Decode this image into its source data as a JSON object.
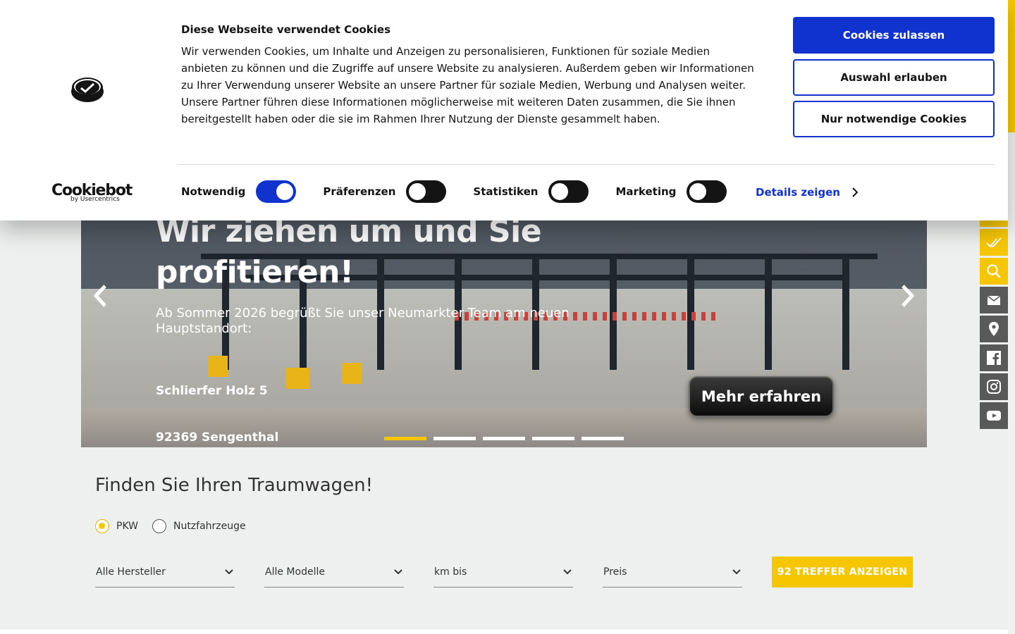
{
  "cookie_banner": {
    "brand": "Cookiebot",
    "brand_sub": "by Usercentrics",
    "heading": "Diese Webseite verwendet Cookies",
    "text": "Wir verwenden Cookies, um Inhalte und Anzeigen zu personalisieren, Funktionen für soziale Medien anbieten zu können und die Zugriffe auf unsere Website zu analysieren. Außerdem geben wir Informationen zu Ihrer Verwendung unserer Website an unsere Partner für soziale Medien, Werbung und Analysen weiter. Unsere Partner führen diese Informationen möglicherweise mit weiteren Daten zusammen, die Sie ihnen bereitgestellt haben oder die sie im Rahmen Ihrer Nutzung der Dienste gesammelt haben.",
    "buttons": {
      "allow_all": "Cookies zulassen",
      "allow_selection": "Auswahl erlauben",
      "necessary_only": "Nur notwendige Cookies"
    },
    "toggles": [
      {
        "label": "Notwendig",
        "on": true
      },
      {
        "label": "Präferenzen",
        "on": false
      },
      {
        "label": "Statistiken",
        "on": false
      },
      {
        "label": "Marketing",
        "on": false
      }
    ],
    "details_label": "Details zeigen",
    "accent_color": "#1032cf"
  },
  "hero": {
    "title_line1": "Wir ziehen um und Sie",
    "title_line2": "profitieren!",
    "subtitle": "Ab Sommer 2026 begrüßt Sie unser Neumarkter Team am neuen Hauptstandort:",
    "address_line1": "Schlierfer Holz 5",
    "address_line2": "92369 Sengenthal",
    "cta": "Mehr erfahren",
    "slide_count": 5,
    "active_slide": 1
  },
  "search": {
    "title": "Finden Sie Ihren Traumwagen!",
    "vehicle_types": [
      {
        "label": "PKW",
        "checked": true
      },
      {
        "label": "Nutzfahrzeuge",
        "checked": false
      }
    ],
    "selects": [
      "Alle Hersteller",
      "Alle Modelle",
      "km bis",
      "Preis"
    ],
    "results_button": "92 TREFFER ANZEIGEN",
    "accent_color": "#f6c700"
  },
  "side_bar": {
    "icons": [
      "chevron-icon",
      "checklist-icon",
      "search-icon",
      "mail-icon",
      "location-icon",
      "facebook-icon",
      "instagram-icon",
      "youtube-icon"
    ]
  }
}
